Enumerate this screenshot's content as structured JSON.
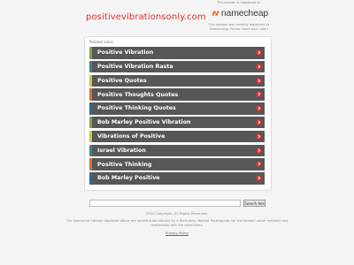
{
  "header": {
    "domain": "positivevibrationsonly.com",
    "registered_text": "This domain is registered at",
    "registrar_name": "namecheap",
    "registrar_note": "This domain was recently registered at Namecheap. Please check back later!"
  },
  "related": {
    "title": "Related Links",
    "items": [
      {
        "label": "Positive Vibration",
        "color": "#7da84a"
      },
      {
        "label": "Positive Vibration Rasta",
        "color": "#3c8b7e"
      },
      {
        "label": "Positive Quotes",
        "color": "#c9c83a"
      },
      {
        "label": "Positive Thoughts Quotes",
        "color": "#d87230"
      },
      {
        "label": "Positive Thinking Quotes",
        "color": "#2c6a9a"
      },
      {
        "label": "Bob Marley Positive Vibration",
        "color": "#7da84a"
      },
      {
        "label": "Vibrations of Positive",
        "color": "#c9c83a"
      },
      {
        "label": "Israel Vibration",
        "color": "#3c8b7e"
      },
      {
        "label": "Positive Thinking",
        "color": "#d87230"
      },
      {
        "label": "Bob Marley Positive",
        "color": "#2c6a9a"
      }
    ],
    "arrow_color": "#d8322c",
    "arrow_icon": "chevron-right-circle-icon"
  },
  "search": {
    "placeholder": "",
    "button_label": "Search Ads"
  },
  "footer": {
    "copyright": "2020 Copyright. All Rights Reserved.",
    "disclaimer": "The Sponsored Listings displayed above are served automatically by a third party. Neither Parkingcrew nor the domain owner maintain any relationship with the advertisers.",
    "privacy_label": "Privacy Policy"
  },
  "colors": {
    "brand_red": "#d8322c",
    "item_bg": "#575757",
    "nc_orange": "#f15a29"
  }
}
